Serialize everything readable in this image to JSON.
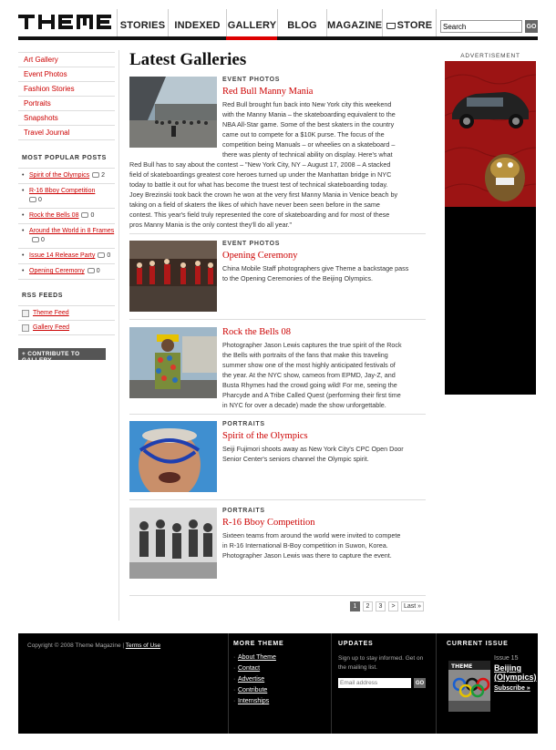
{
  "header": {
    "logo_text": "THEME",
    "nav": [
      {
        "label": "STORIES",
        "name": "nav-stories"
      },
      {
        "label": "INDEXED",
        "name": "nav-indexed"
      },
      {
        "label": "GALLERY",
        "name": "nav-gallery",
        "active": true
      },
      {
        "label": "BLOG",
        "name": "nav-blog"
      },
      {
        "label": "MAGAZINE",
        "name": "nav-magazine"
      },
      {
        "label": "STORE",
        "name": "nav-store",
        "icon": "cart-icon"
      }
    ],
    "search_value": "Search",
    "search_button": "GO"
  },
  "sidebar": {
    "categories": [
      "Art Gallery",
      "Event Photos",
      "Fashion Stories",
      "Portraits",
      "Snapshots",
      "Travel Journal"
    ],
    "popular_heading": "MOST POPULAR POSTS",
    "popular": [
      {
        "title": "Spirit of the Olympics",
        "comments": "2"
      },
      {
        "title": "R-16 Bboy Competition",
        "comments": "0"
      },
      {
        "title": "Rock the Bells 08",
        "comments": "0"
      },
      {
        "title": "Around the World in 8 Frames",
        "comments": "0"
      },
      {
        "title": "Issue 14 Release Party",
        "comments": "0"
      },
      {
        "title": "Opening Ceremony",
        "comments": "0"
      }
    ],
    "rss_heading": "RSS FEEDS",
    "rss": [
      "Theme Feed",
      "Gallery Feed"
    ],
    "contribute_label": "+ CONTRIBUTE TO GALLERY"
  },
  "main": {
    "title": "Latest Galleries",
    "entries": [
      {
        "category": "EVENT PHOTOS",
        "title": "Red Bull Manny Mania",
        "text_side": [
          "Red Bull brought fun back into New York city this weekend",
          "with the Manny Mania – the skateboarding equivalent to the",
          "NBA All-Star game. Some of the best skaters in the country",
          "came out to compete for a $10K purse. The focus of the",
          "competition being Manuals – or wheelies on a skateboard –",
          "there was plenty of technical ability on display. Here's what"
        ],
        "text_full": [
          "Red Bull has to say about the contest – \"New York City, NY – August 17, 2008 – A stacked",
          "field of skateboardings greatest core heroes turned up under the Manhattan bridge in NYC",
          "today to battle it out for what has become the truest test of technical skateboarding today.",
          "Joey Brezinski took back the crown he won at the very first Manny Mania in Venice beach by",
          "taking on a field of skaters the likes of which have never been seen before in the same",
          "contest.  This year's field truly represented the core of skateboarding and for most of these",
          "pros Manny Mania is the only contest they'll do all year.\""
        ]
      },
      {
        "category": "EVENT PHOTOS",
        "title": "Opening Ceremony",
        "text_side": [
          "China Mobile Staff photographers give Theme a backstage pass",
          "to the Opening Ceremonies of the Beijing Olympics."
        ]
      },
      {
        "category": "",
        "title": "Rock the Bells 08",
        "text_side": [
          "Photographer Jason Lewis captures the true spirit of the Rock",
          "the Bells with portraits of the fans that make this traveling",
          "summer show one of the most highly anticipated festivals of",
          "the year. At the NYC show, cameos from EPMD, Jay-Z, and",
          "Busta Rhymes had the crowd going wild! For me, seeing the",
          "Pharcyde and A Tribe Called Quest (performing their first time",
          "in NYC for over a decade) made the show unforgettable."
        ]
      },
      {
        "category": "PORTRAITS",
        "title": "Spirit of the Olympics",
        "text_side": [
          "Seiji Fujimori shoots away as New York City's CPC Open Door",
          "Senior Center's seniors channel the Olympic spirit."
        ]
      },
      {
        "category": "PORTRAITS",
        "title": "R-16 Bboy Competition",
        "text_side": [
          "Sixteen teams from around the world were invited to compete",
          "in R-16 International B-Boy competition in Suwon, Korea.",
          "Photographer Jason Lewis was there to capture the event."
        ]
      }
    ],
    "pager": [
      "1",
      "2",
      "3",
      ">",
      "Last »"
    ]
  },
  "ad": {
    "label": "ADVERTISEMENT"
  },
  "footer": {
    "copyright": "Copyright © 2008 Theme Magazine |",
    "terms": "Terms of Use",
    "more_heading": "MORE THEME",
    "more_links": [
      "About Theme",
      "Contact",
      "Advertise",
      "Contribute",
      "Internships"
    ],
    "updates_heading": "UPDATES",
    "updates_text": "Sign up to stay informed. Get on the mailing list.",
    "email_placeholder": "Email address",
    "email_go": "GO",
    "issue_heading": "CURRENT ISSUE",
    "issue_number": "Issue 15",
    "issue_title": "Beijing (Olympics)",
    "subscribe": "Subscribe »",
    "cover_logo": "THEME"
  },
  "colors": {
    "accent": "#cc0000",
    "footer_bg": "#000000",
    "nav_bar": "#111111"
  }
}
